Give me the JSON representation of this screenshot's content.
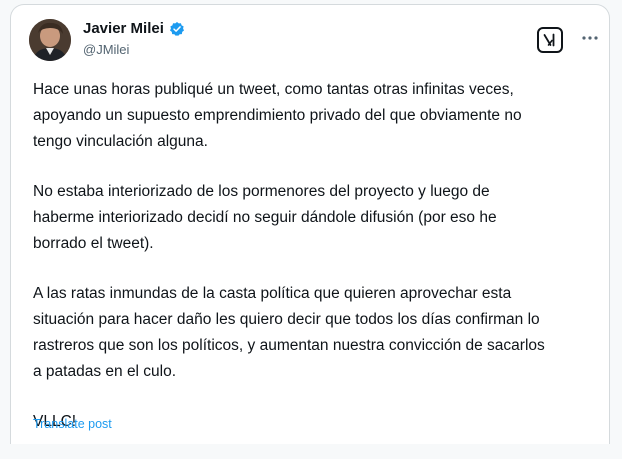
{
  "author": {
    "display_name": "Javier Milei",
    "handle": "@JMilei",
    "verified_icon": "verified-badge-icon",
    "verified_color": "#1d9bf0"
  },
  "actions": {
    "grok_icon": "grok-icon",
    "more_icon": "more-horizontal-icon"
  },
  "tweet": {
    "paragraphs": [
      "Hace unas horas publiqué un tweet, como tantas otras infinitas veces,\napoyando un supuesto emprendimiento privado del que obviamente no\ntengo vinculación alguna.",
      "No estaba interiorizado de los pormenores del proyecto y luego de\nhaberme interiorizado decidí no seguir dándole difusión (por eso he\nborrado el tweet).",
      "A las ratas inmundas de la casta política que quieren aprovechar esta\nsituación para hacer daño les quiero decir que todos los días confirman lo\nrastreros que son los políticos, y aumentan nuestra convicción de sacarlos\na patadas en el culo.",
      "VLLC!"
    ],
    "translate_label": "Translate post"
  },
  "colors": {
    "text": "#0f1419",
    "secondary_text": "#536471",
    "link": "#1d9bf0",
    "border": "#d5dadd"
  }
}
